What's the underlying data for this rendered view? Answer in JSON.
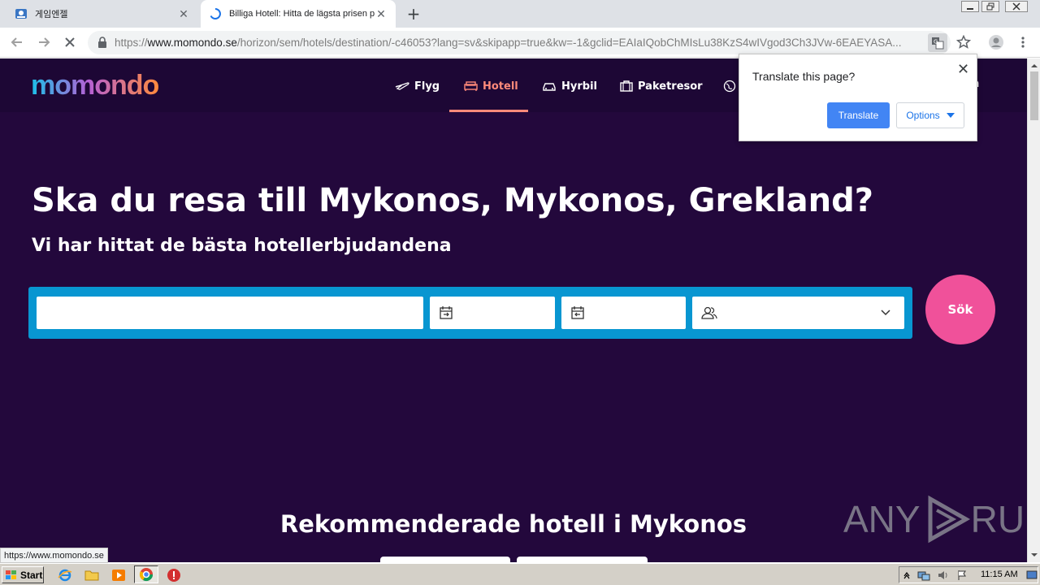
{
  "browser": {
    "tabs": [
      {
        "title": "게임엔젤",
        "active": false
      },
      {
        "title": "Billiga Hotell: Hitta de lägsta prisen p",
        "active": true
      }
    ],
    "url_scheme": "https://",
    "url_host": "www.momondo.se",
    "url_path": "/horizon/sem/hotels/destination/-c46053?lang=sv&skipapp=true&kw=-1&gclid=EAIaIQobChMIsLu38KzS4wIVgod3Ch3JVw-6EAEYASA..."
  },
  "site": {
    "logo": "momondo",
    "nav": [
      {
        "label": "Flyg",
        "icon": "plane-icon"
      },
      {
        "label": "Hotell",
        "icon": "bed-icon",
        "active": true
      },
      {
        "label": "Hyrbil",
        "icon": "car-icon"
      },
      {
        "label": "Paketresor",
        "icon": "suitcase-icon"
      }
    ],
    "nav_partial": "n",
    "headline": "Ska du resa till Mykonos, Mykonos, Grekland?",
    "subhead": "Vi har hittat de bästa hotellerbjudandena",
    "search": {
      "destination_value": "",
      "checkin_value": "",
      "checkout_value": "",
      "guests_value": "",
      "submit_label": "Sök"
    },
    "recommended_title": "Rekommenderade hotell i Mykonos"
  },
  "translate_bubble": {
    "question": "Translate this page?",
    "translate_label": "Translate",
    "options_label": "Options"
  },
  "status_url": "https://www.momondo.se",
  "watermark": {
    "left": "ANY",
    "right": "RUN"
  },
  "taskbar": {
    "start_label": "Start",
    "clock": "11:15 AM"
  },
  "colors": {
    "page_bg": "#23083c",
    "search_bar": "#0896d1",
    "search_button": "#f0519a",
    "active_nav": "#ff8a7a",
    "translate_button": "#4285f4"
  }
}
